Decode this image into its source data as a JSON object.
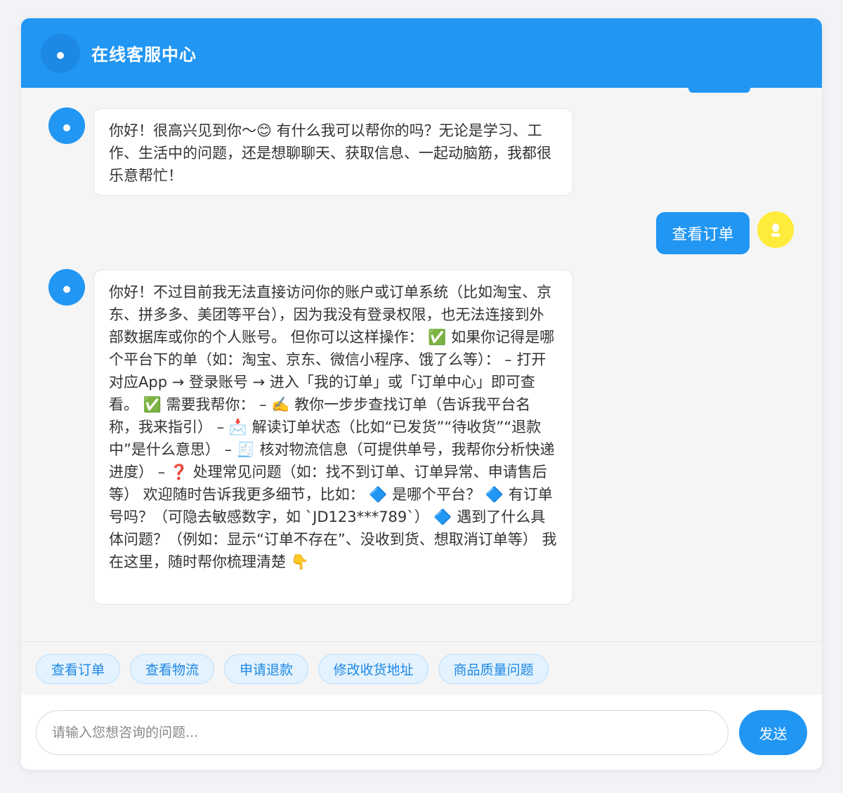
{
  "header": {
    "title": "在线客服中心"
  },
  "messages": [
    {
      "role": "bot",
      "text": "你好！很高兴见到你～😊 有什么我可以帮你的吗？无论是学习、工作、生活中的问题，还是想聊聊天、获取信息、一起动脑筋，我都很乐意帮忙！"
    },
    {
      "role": "user",
      "text": "查看订单"
    },
    {
      "role": "bot",
      "text": "你好！不过目前我无法直接访问你的账户或订单系统（比如淘宝、京东、拼多多、美团等平台），因为我没有登录权限，也无法连接到外部数据库或你的个人账号。 但你可以这样操作： ✅ 如果你记得是哪个平台下的单（如：淘宝、京东、微信小程序、饿了么等）： – 打开对应App → 登录账号 → 进入「我的订单」或「订单中心」即可查看。 ✅ 需要我帮你： – ✍️ 教你一步步查找订单（告诉我平台名称，我来指引） – 📩 解读订单状态（比如“已发货”“待收货”“退款中”是什么意思） – 🧾 核对物流信息（可提供单号，我帮你分析快递进度） – ❓ 处理常见问题（如：找不到订单、订单异常、申请售后等） 欢迎随时告诉我更多细节，比如： 🔷 是哪个平台？ 🔷 有订单号吗？（可隐去敏感数字，如 `JD123***789`） 🔷 遇到了什么具体问题？（例如：显示“订单不存在”、没收到货、想取消订单等） 我在这里，随时帮你梳理清楚 👇"
    }
  ],
  "quick_replies": [
    "查看订单",
    "查看物流",
    "申请退款",
    "修改收货地址",
    "商品质量问题"
  ],
  "input": {
    "value": "",
    "placeholder": "请输入您想咨询的问题..."
  },
  "send_label": "发送",
  "colors": {
    "primary": "#2196f3",
    "user_avatar": "#ffeb3b",
    "quick_bg": "#e3f2fd",
    "quick_text": "#1e88e5"
  }
}
